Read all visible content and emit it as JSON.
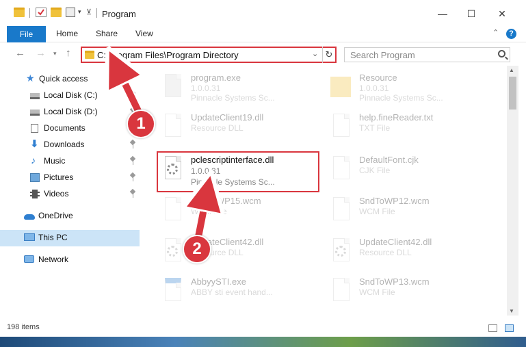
{
  "window": {
    "title": "Program"
  },
  "ribbon": {
    "tabs": [
      {
        "label": "File"
      },
      {
        "label": "Home"
      },
      {
        "label": "Share"
      },
      {
        "label": "View"
      }
    ]
  },
  "address": {
    "path": "C:\\Program Files\\Program Directory"
  },
  "search": {
    "placeholder": "Search Program"
  },
  "sidebar": {
    "items": [
      {
        "label": "Quick access",
        "icon": "star-icon"
      },
      {
        "label": "Local Disk (C:)",
        "icon": "drive-icon",
        "pinned": true
      },
      {
        "label": "Local Disk (D:)",
        "icon": "drive-icon",
        "pinned": true
      },
      {
        "label": "Documents",
        "icon": "documents-icon",
        "pinned": true
      },
      {
        "label": "Downloads",
        "icon": "download-icon",
        "pinned": true
      },
      {
        "label": "Music",
        "icon": "music-icon",
        "pinned": true
      },
      {
        "label": "Pictures",
        "icon": "pictures-icon",
        "pinned": true
      },
      {
        "label": "Videos",
        "icon": "videos-icon",
        "pinned": true
      },
      {
        "label": "OneDrive",
        "icon": "cloud-icon"
      },
      {
        "label": "This PC",
        "icon": "computer-icon",
        "selected": true
      },
      {
        "label": "Network",
        "icon": "network-icon"
      }
    ]
  },
  "files": [
    {
      "name": "program.exe",
      "sub1": "1.0.0.31",
      "sub2": "Pinnacle Systems Sc...",
      "icon": "exe-icon"
    },
    {
      "name": "Resource",
      "sub1": "1.0.0.31",
      "sub2": "Pinnacle Systems Sc...",
      "icon": "folder-icon"
    },
    {
      "name": "UpdateClient19.dll",
      "sub1": "Resource DLL",
      "icon": "dll-icon"
    },
    {
      "name": "help.fineReader.txt",
      "sub1": "TXT File",
      "icon": "txt-icon"
    },
    {
      "name": "pclescriptinterface.dll",
      "sub1": "1.0.0.31",
      "sub2": "Pinnacle Systems Sc...",
      "icon": "dll-gear-icon",
      "highlighted": true
    },
    {
      "name": "DefaultFont.cjk",
      "sub1": "CJK File",
      "icon": "file-icon"
    },
    {
      "name": "SndToWP15.wcm",
      "sub1": "WCM File",
      "icon": "file-icon"
    },
    {
      "name": "SndToWP12.wcm",
      "sub1": "WCM File",
      "icon": "file-icon"
    },
    {
      "name": "UpdateClient42.dll",
      "sub1": "Resource DLL",
      "icon": "dll-icon"
    },
    {
      "name": "UpdateClient42.dll",
      "sub1": "Resource DLL",
      "icon": "dll-icon"
    },
    {
      "name": "AbbyySTI.exe",
      "sub1": "ABBY sti event hand...",
      "icon": "exe-icon"
    },
    {
      "name": "SndToWP13.wcm",
      "sub1": "WCM File",
      "icon": "file-icon"
    }
  ],
  "status": {
    "item_count": "198 items"
  },
  "annotations": {
    "step1": "1",
    "step2": "2"
  },
  "colors": {
    "accent": "#1979ca",
    "highlight": "#d9363e",
    "selection": "#cce4f7"
  }
}
